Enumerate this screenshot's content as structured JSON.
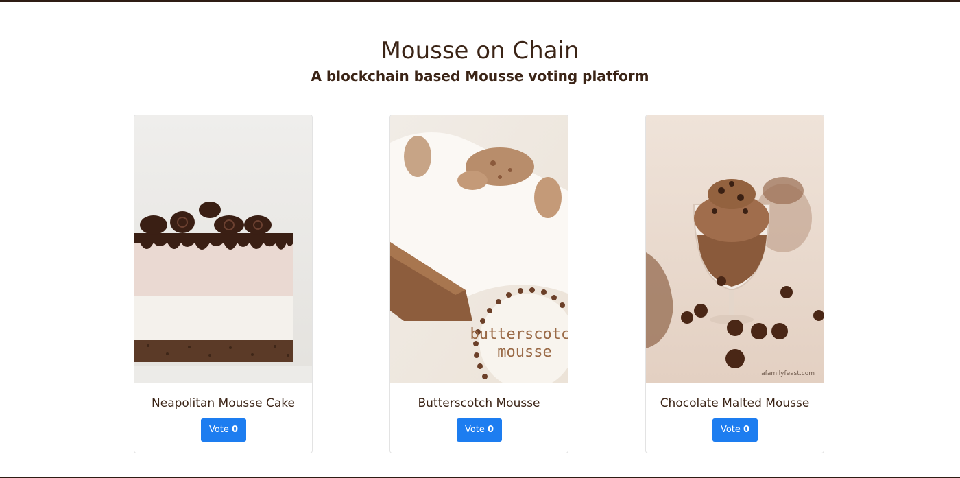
{
  "header": {
    "title": "Mousse on Chain",
    "subtitle": "A blockchain based Mousse voting platform"
  },
  "candidates": [
    {
      "name": "Neapolitan Mousse Cake",
      "vote_label": "Vote",
      "votes": "0"
    },
    {
      "name": "Butterscotch Mousse",
      "vote_label": "Vote",
      "votes": "0",
      "image_text": [
        "butterscotch",
        "mousse"
      ]
    },
    {
      "name": "Chocolate Malted Mousse",
      "vote_label": "Vote",
      "votes": "0",
      "image_credit": "afamilyfeast.com"
    }
  ],
  "colors": {
    "accent": "#1d7df0",
    "text": "#3b2416",
    "rule": "#2e1c14"
  }
}
